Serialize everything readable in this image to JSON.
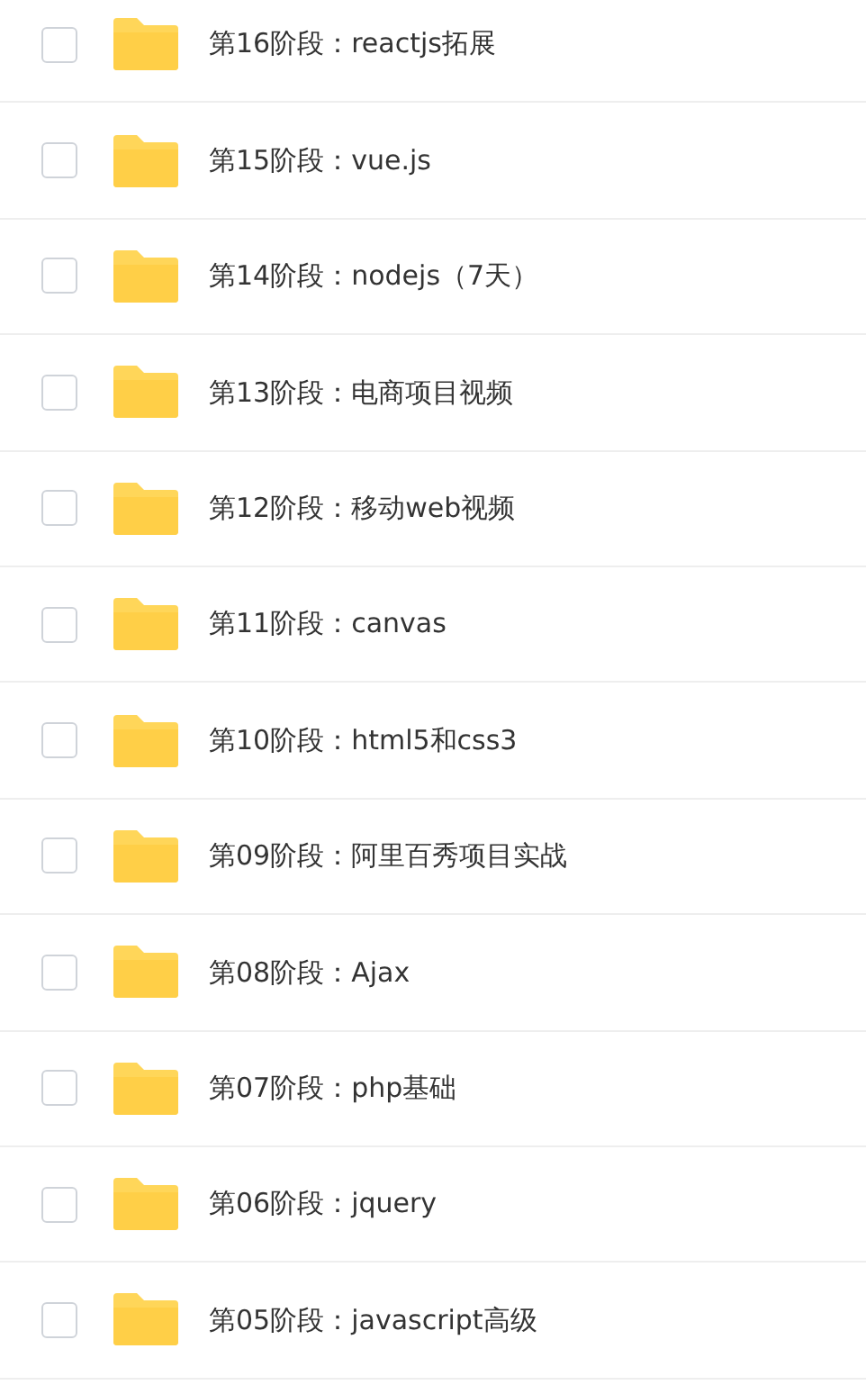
{
  "folders": [
    {
      "name": "第16阶段：reactjs拓展",
      "checked": false
    },
    {
      "name": "第15阶段：vue.js",
      "checked": false
    },
    {
      "name": "第14阶段：nodejs（7天）",
      "checked": false
    },
    {
      "name": "第13阶段：电商项目视频",
      "checked": false
    },
    {
      "name": "第12阶段：移动web视频",
      "checked": false
    },
    {
      "name": "第11阶段：canvas",
      "checked": false
    },
    {
      "name": "第10阶段：html5和css3",
      "checked": false
    },
    {
      "name": "第09阶段：阿里百秀项目实战",
      "checked": false
    },
    {
      "name": "第08阶段：Ajax",
      "checked": false
    },
    {
      "name": "第07阶段：php基础",
      "checked": false
    },
    {
      "name": "第06阶段：jquery",
      "checked": false
    },
    {
      "name": "第05阶段：javascript高级",
      "checked": false
    }
  ]
}
